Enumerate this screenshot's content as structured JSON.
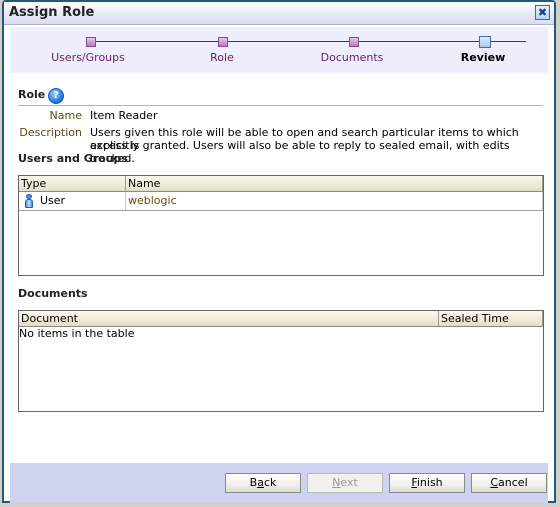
{
  "dialog": {
    "title": "Assign Role",
    "close_icon": "close-icon"
  },
  "train": {
    "stops": [
      {
        "label": "Users/Groups",
        "state": "visited"
      },
      {
        "label": "Role",
        "state": "visited"
      },
      {
        "label": "Documents",
        "state": "visited"
      },
      {
        "label": "Review",
        "state": "current"
      }
    ]
  },
  "role": {
    "section_title": "Role",
    "help_icon": "?",
    "name_label": "Name",
    "name_value": "Item Reader",
    "description_label": "Description",
    "description_line1": "Users given this role will be able to open and search particular items to which access is",
    "description_line2": "explicitly granted. Users will also be able to reply to sealed email, with edits tracked."
  },
  "users_groups": {
    "section_title": "Users and Groups",
    "columns": [
      "Type",
      "Name"
    ],
    "rows": [
      {
        "type": "User",
        "type_icon": "user-icon",
        "name": "weblogic"
      }
    ]
  },
  "documents": {
    "section_title": "Documents",
    "columns": [
      "Document",
      "Sealed Time"
    ],
    "empty_message": "No items in the table"
  },
  "footer": {
    "back": {
      "pre": "B",
      "accel": "a",
      "post": "ck"
    },
    "next": {
      "pre": "",
      "accel": "N",
      "post": "ext",
      "disabled": true
    },
    "finish": {
      "pre": "",
      "accel": "F",
      "post": "inish"
    },
    "cancel": {
      "pre": "",
      "accel": "C",
      "post": "ancel"
    }
  }
}
